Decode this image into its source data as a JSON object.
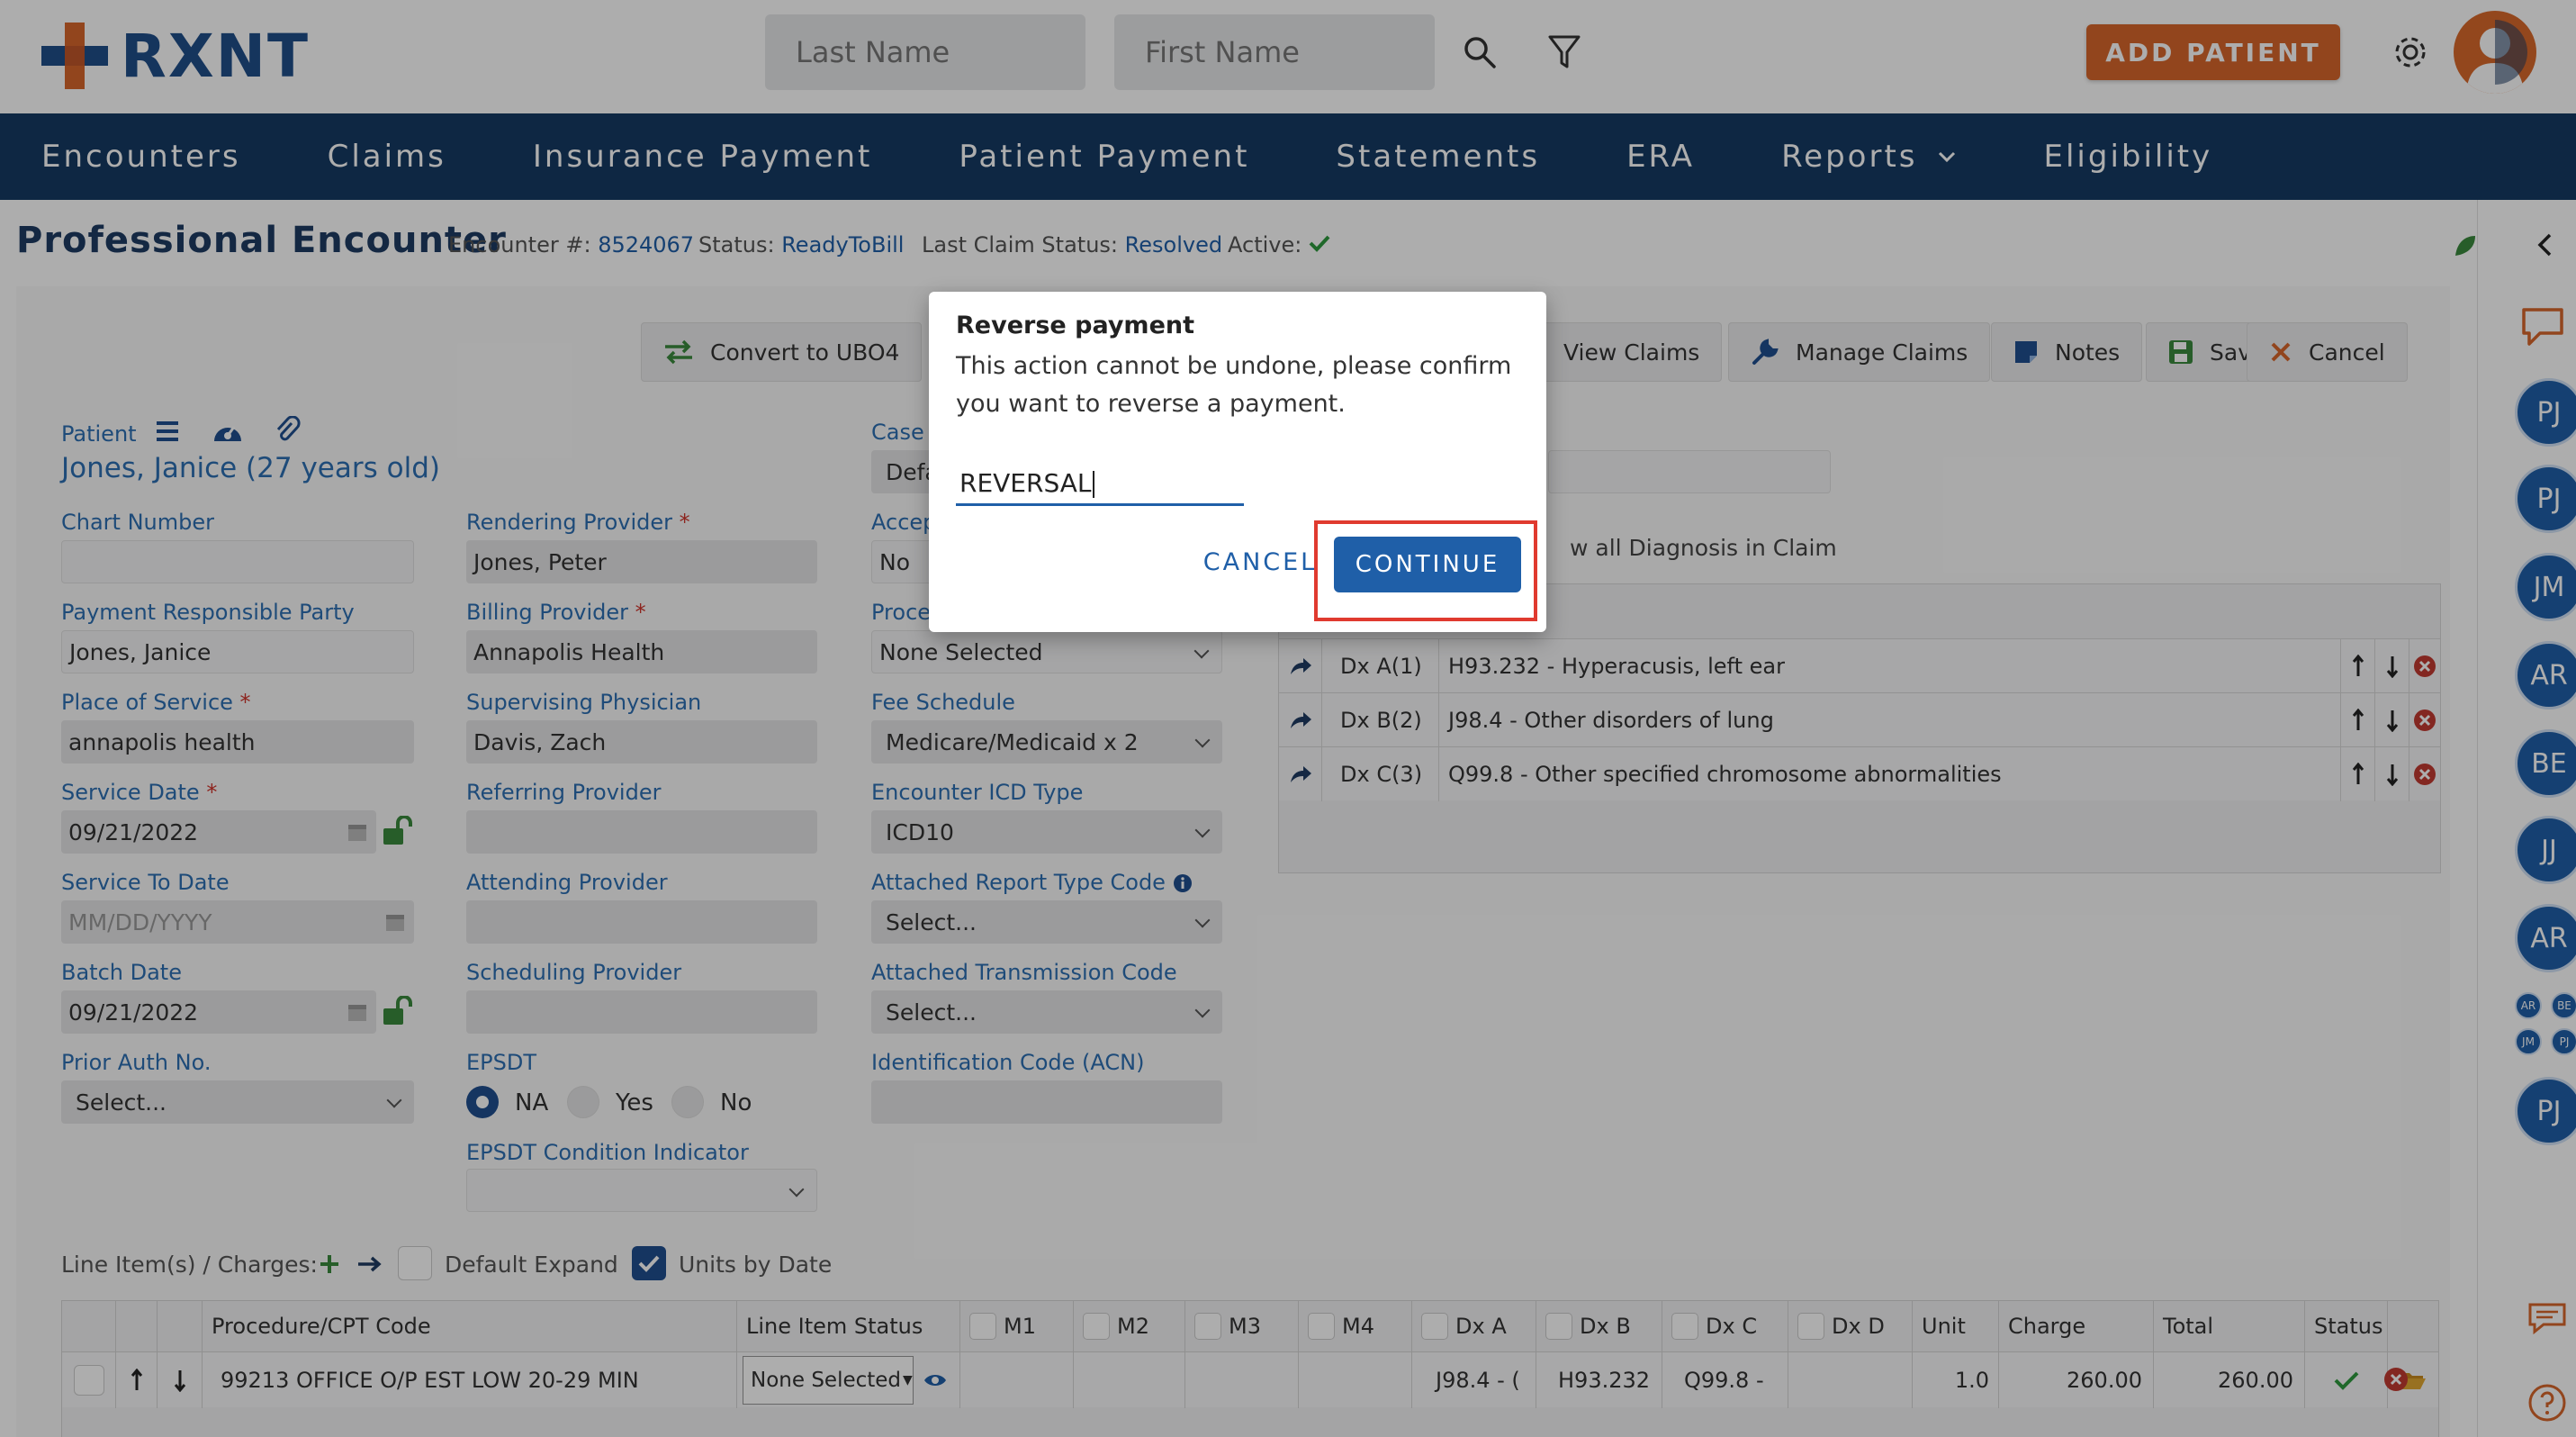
{
  "brand": {
    "name": "RXNT",
    "accent": "#d7662b",
    "primary": "#1f4e8a"
  },
  "header": {
    "last_name_placeholder": "Last Name",
    "first_name_placeholder": "First Name",
    "add_patient": "ADD PATIENT",
    "icons": [
      "search-icon",
      "filter-icon",
      "gear-icon",
      "user-avatar"
    ]
  },
  "nav": {
    "encounters": "Encounters",
    "claims": "Claims",
    "insurance_payment": "Insurance Payment",
    "patient_payment": "Patient Payment",
    "statements": "Statements",
    "era": "ERA",
    "reports": "Reports",
    "eligibility": "Eligibility"
  },
  "page": {
    "title": "Professional Encounter",
    "encounter_label": "Encounter #:",
    "encounter_no": "8524067",
    "status_label": "Status:",
    "status": "ReadyToBill",
    "last_claim_label": "Last Claim Status:",
    "last_claim": "Resolved",
    "active_label": "Active:"
  },
  "toolbar": {
    "convert": "Convert to UBO4",
    "view_claims": "View Claims",
    "manage_claims": "Manage Claims",
    "notes": "Notes",
    "save": "Save",
    "cancel": "Cancel"
  },
  "patient": {
    "label": "Patient",
    "name": "Jones, Janice (27 years old)"
  },
  "form": {
    "chart_number_label": "Chart Number",
    "chart_number": "",
    "payment_party_label": "Payment Responsible Party",
    "payment_party": "Jones, Janice",
    "place_of_service_label": "Place of Service",
    "place_of_service": "annapolis health",
    "service_date_label": "Service Date",
    "service_date": "09/21/2022",
    "service_to_label": "Service To Date",
    "service_to_placeholder": "MM/DD/YYYY",
    "batch_date_label": "Batch Date",
    "batch_date": "09/21/2022",
    "prior_auth_label": "Prior Auth No.",
    "prior_auth": "Select...",
    "rendering_label": "Rendering Provider",
    "rendering": "Jones, Peter",
    "billing_label": "Billing Provider",
    "billing": "Annapolis Health",
    "supervising_label": "Supervising Physician",
    "supervising": "Davis, Zach",
    "referring_label": "Referring Provider",
    "attending_label": "Attending Provider",
    "scheduling_label": "Scheduling Provider",
    "epsdt_label": "EPSDT",
    "epsdt_na": "NA",
    "epsdt_yes": "Yes",
    "epsdt_no": "No",
    "epsdt_condition_label": "EPSDT Condition Indicator",
    "case_label": "Case",
    "case_value": "Defa",
    "accept_label": "Accep",
    "accept_value": "No",
    "proc_label": "Proce",
    "proc_value": "None Selected",
    "fee_schedule_label": "Fee Schedule",
    "fee_schedule": "Medicare/Medicaid x 2",
    "icd_type_label": "Encounter ICD Type",
    "icd_type": "ICD10",
    "report_type_label": "Attached Report Type Code",
    "report_type": "Select...",
    "transmission_label": "Attached Transmission Code",
    "transmission": "Select...",
    "acn_label": "Identification Code (ACN)"
  },
  "diagnosis": {
    "show_all": "w all Diagnosis in Claim",
    "rows": [
      {
        "code": "Dx A(1)",
        "desc": "H93.232 - Hyperacusis, left ear"
      },
      {
        "code": "Dx B(2)",
        "desc": "J98.4 - Other disorders of lung"
      },
      {
        "code": "Dx C(3)",
        "desc": "Q99.8 - Other specified chromosome abnormalities"
      }
    ]
  },
  "line_items": {
    "label": "Line Item(s) / Charges:",
    "default_expand": "Default Expand",
    "units_by_date": "Units by Date",
    "headers": {
      "procedure": "Procedure/CPT Code",
      "status": "Line Item Status",
      "m1": "M1",
      "m2": "M2",
      "m3": "M3",
      "m4": "M4",
      "dxa": "Dx A",
      "dxb": "Dx B",
      "dxc": "Dx C",
      "dxd": "Dx D",
      "unit": "Unit",
      "charge": "Charge",
      "total": "Total",
      "status_col": "Status"
    },
    "row": {
      "procedure": "99213 OFFICE O/P EST LOW 20-29 MIN",
      "status": "None Selected",
      "dxa": "J98.4 - (",
      "dxb": "H93.232",
      "dxc": "Q99.8 -",
      "unit": "1.0",
      "charge": "260.00",
      "total": "260.00"
    }
  },
  "sidebar": {
    "avatars": [
      "PJ",
      "PJ",
      "JM",
      "AR",
      "BE",
      "JJ",
      "AR",
      "PJ"
    ],
    "group": [
      "AR",
      "BE",
      "JM",
      "PJ"
    ]
  },
  "dialog": {
    "title": "Reverse payment",
    "body": "This action cannot be undone, please confirm you want to reverse a payment.",
    "input_value": "REVERSAL",
    "cancel": "CANCEL",
    "continue": "CONTINUE"
  }
}
